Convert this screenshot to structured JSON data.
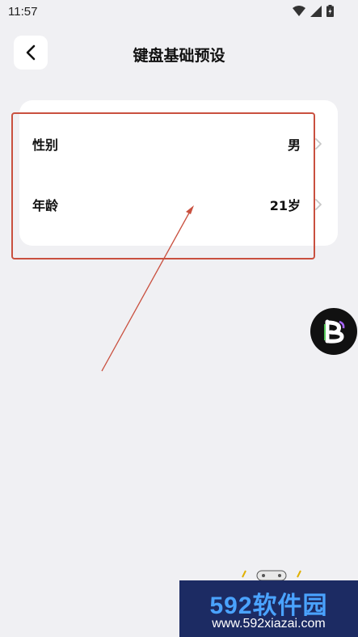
{
  "status": {
    "time": "11:57"
  },
  "header": {
    "title": "键盘基础预设",
    "back_icon": "chevron-left-icon"
  },
  "settings": [
    {
      "label": "性别",
      "value": "男"
    },
    {
      "label": "年龄",
      "value": "21岁"
    }
  ],
  "watermark": {
    "line1": "592软件园",
    "line2": "www.592xiazai.com"
  },
  "colors": {
    "background": "#f0f0f3",
    "card": "#ffffff",
    "annotation": "#c9503f"
  }
}
